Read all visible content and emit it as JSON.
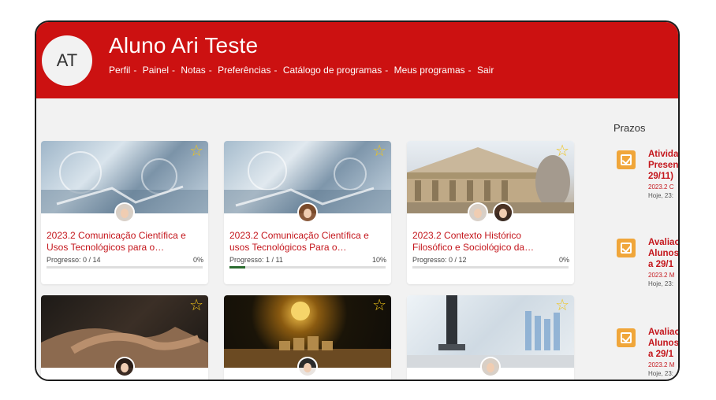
{
  "header": {
    "avatar_initials": "AT",
    "user_name": "Aluno Ari Teste",
    "nav": [
      "Perfil",
      "Painel",
      "Notas",
      "Preferências",
      "Catálogo de programas",
      "Meus programas",
      "Sair"
    ],
    "nav_separator": "-",
    "color": "#cc1111"
  },
  "courses": [
    {
      "title_line1": "2023.2 Comunicação Científica e",
      "title_line2": "Usos Tecnológicos para o…",
      "progress_label": "Progresso: 0 / 14",
      "progress_pct": "0%",
      "progress": 0
    },
    {
      "title_line1": "2023.2 Comunicação Científica e",
      "title_line2": "usos Tecnológicos Para o…",
      "progress_label": "Progresso: 1 / 11",
      "progress_pct": "10%",
      "progress": 0.1
    },
    {
      "title_line1": "2023.2 Contexto Histórico",
      "title_line2": "Filosófico e Sociológico da…",
      "progress_label": "Progresso: 0 / 12",
      "progress_pct": "0%",
      "progress": 0
    },
    {
      "title_line1": "",
      "title_line2": "",
      "progress_label": "",
      "progress_pct": ""
    },
    {
      "title_line1": "",
      "title_line2": "",
      "progress_label": "",
      "progress_pct": ""
    },
    {
      "title_line1": "",
      "title_line2": "",
      "progress_label": "",
      "progress_pct": ""
    }
  ],
  "star_glyph": "☆",
  "deadlines": {
    "title": "Prazos",
    "items": [
      {
        "line1": "Ativida",
        "line2": "Presen",
        "line3": "29/11)",
        "course": "2023.2 C",
        "when": "Hoje, 23:"
      },
      {
        "line1": "Avaliac",
        "line2": "Alunos",
        "line3": "a 29/1",
        "course": "2023.2 M",
        "when": "Hoje, 23:"
      },
      {
        "line1": "Avaliac",
        "line2": "Alunos",
        "line3": "a 29/1",
        "course": "2023.2 M",
        "when": "Hoje, 23:"
      }
    ],
    "icon": "checkbox-icon",
    "icon_color": "#f0a63a"
  },
  "colors": {
    "accent": "#c4161c",
    "progress": "#2a6b2e",
    "star": "#f0c419"
  }
}
